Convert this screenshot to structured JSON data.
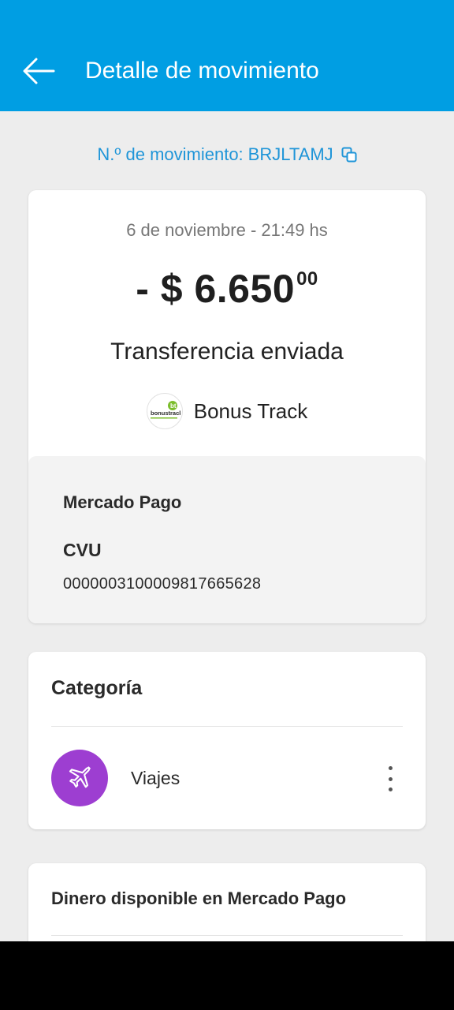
{
  "header": {
    "title": "Detalle de movimiento",
    "background_color": "#009ee3"
  },
  "movement": {
    "label": "N.º de movimiento:",
    "id": "BRJLTAMJ"
  },
  "detail": {
    "date": "6 de noviembre - 21:49 hs",
    "amount_main": "- $ 6.650",
    "amount_cents": "00",
    "type": "Transferencia enviada",
    "merchant_name": "Bonus Track",
    "merchant_logo_text": "bonustrack"
  },
  "destination": {
    "bank": "Mercado Pago",
    "cvu_label": "CVU",
    "cvu_value": "0000003100009817665628"
  },
  "category": {
    "title": "Categoría",
    "name": "Viajes",
    "icon": "airplane-icon",
    "icon_color": "#9d3ed1"
  },
  "money": {
    "title": "Dinero disponible en Mercado Pago"
  },
  "accent_color": "#1f95d8"
}
